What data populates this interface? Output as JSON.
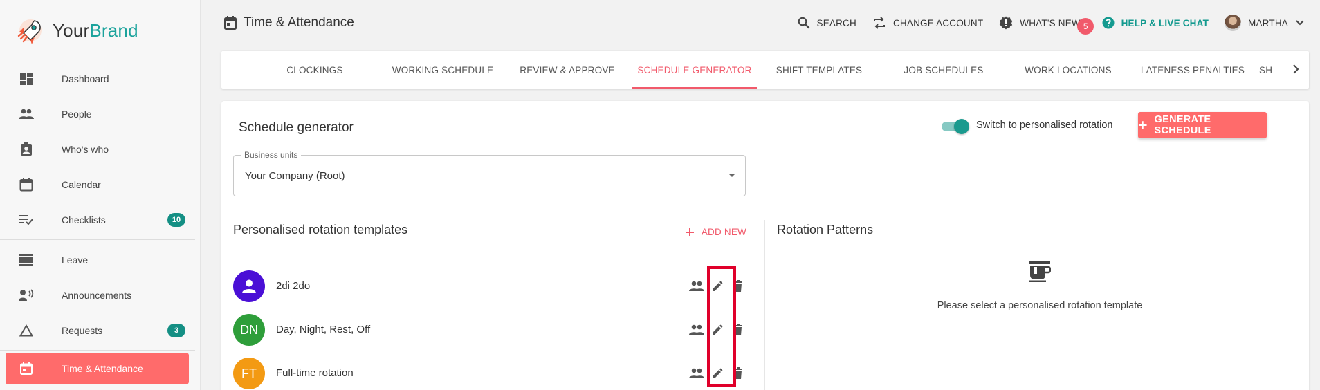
{
  "brand": {
    "name_part1": "Your",
    "name_part2": "Brand"
  },
  "sidebar": {
    "items": [
      {
        "label": "Dashboard",
        "icon": "dashboard-icon"
      },
      {
        "label": "People",
        "icon": "people-icon"
      },
      {
        "label": "Who's who",
        "icon": "badge-icon"
      },
      {
        "label": "Calendar",
        "icon": "calendar-icon"
      },
      {
        "label": "Checklists",
        "icon": "checklist-icon",
        "badge": "10"
      },
      {
        "label": "Leave",
        "icon": "leave-icon"
      },
      {
        "label": "Announcements",
        "icon": "announcement-icon"
      },
      {
        "label": "Requests",
        "icon": "triangle-icon",
        "badge": "3"
      },
      {
        "label": "Time & Attendance",
        "icon": "calendar-today-icon",
        "active": true
      }
    ]
  },
  "header": {
    "title": "Time & Attendance",
    "search": "SEARCH",
    "change_account": "CHANGE ACCOUNT",
    "whats_new": "WHAT'S NEW?",
    "whats_new_count": "5",
    "help": "HELP & LIVE CHAT",
    "user": "MARTHA"
  },
  "tabs": [
    {
      "label": "CLOCKINGS"
    },
    {
      "label": "WORKING SCHEDULE"
    },
    {
      "label": "REVIEW & APPROVE"
    },
    {
      "label": "SCHEDULE GENERATOR",
      "active": true
    },
    {
      "label": "SHIFT TEMPLATES"
    },
    {
      "label": "JOB SCHEDULES"
    },
    {
      "label": "WORK LOCATIONS"
    },
    {
      "label": "LATENESS PENALTIES"
    },
    {
      "label": "SH"
    }
  ],
  "card": {
    "title": "Schedule generator",
    "switch_label": "Switch to personalised rotation",
    "switch_on": true,
    "generate_button": "GENERATE SCHEDULE",
    "business_units_label": "Business units",
    "business_units_value": "Your Company (Root)"
  },
  "templates": {
    "title": "Personalised rotation templates",
    "add_new": "ADD NEW",
    "items": [
      {
        "initials": "",
        "name": "2di 2do",
        "color": "#4a0fd6"
      },
      {
        "initials": "DN",
        "name": "Day, Night, Rest, Off",
        "color": "#2e9e3a"
      },
      {
        "initials": "FT",
        "name": "Full-time rotation",
        "color": "#f39a13"
      }
    ]
  },
  "patterns": {
    "title": "Rotation Patterns",
    "empty_text": "Please select a personalised rotation template"
  },
  "colors": {
    "accent": "#ff6b6b",
    "teal": "#1a9a8e",
    "tab_active": "#f15a6b"
  }
}
